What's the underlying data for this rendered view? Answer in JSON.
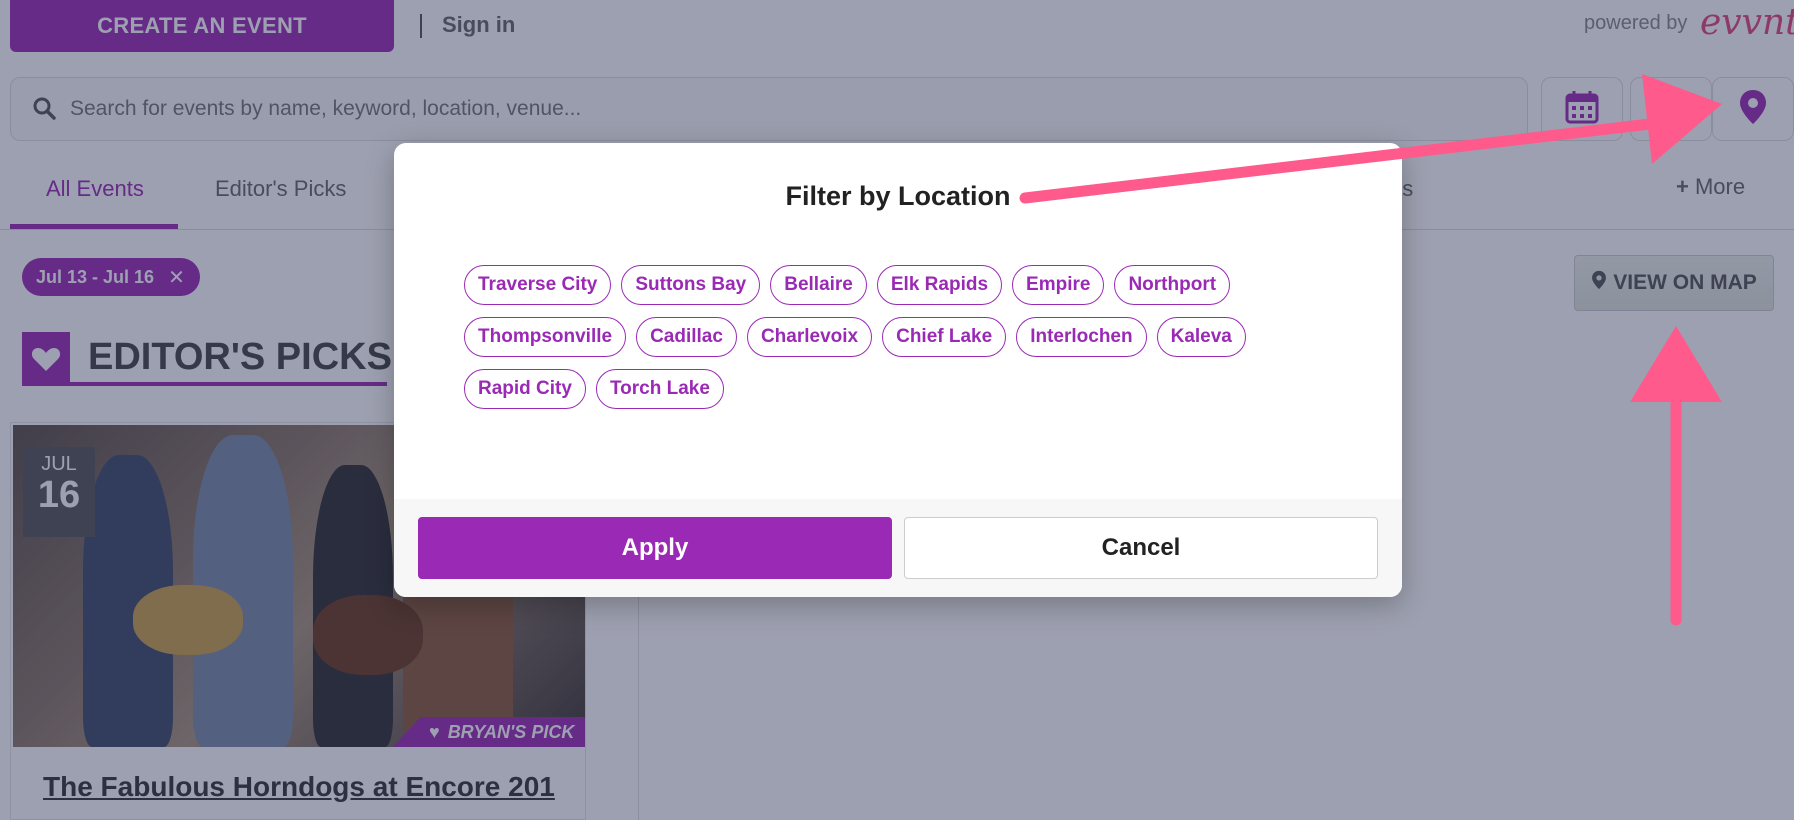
{
  "header": {
    "create_label": "CREATE AN EVENT",
    "signin_label": "Sign in",
    "powered_label": "powered by",
    "brand_label": "evvnt"
  },
  "search": {
    "placeholder": "Search for events by name, keyword, location, venue..."
  },
  "toolbar_icons": [
    "calendar-icon",
    "filter-icon",
    "location-pin-icon"
  ],
  "tabs": {
    "items": [
      {
        "label": "All Events",
        "active": true
      },
      {
        "label": "Editor's Picks",
        "active": false
      },
      {
        "label": "ns",
        "active": false
      }
    ],
    "more_label": "More"
  },
  "filters": {
    "date_chip": "Jul 13 - Jul 16"
  },
  "section": {
    "title": "EDITOR'S PICKS"
  },
  "card": {
    "month": "JUL",
    "day": "16",
    "pick_label": "BRYAN'S PICK",
    "title": "The Fabulous Horndogs at Encore 201"
  },
  "map": {
    "view_label": "VIEW ON MAP"
  },
  "modal": {
    "title": "Filter by Location",
    "locations": [
      "Traverse City",
      "Suttons Bay",
      "Bellaire",
      "Elk Rapids",
      "Empire",
      "Northport",
      "Thompsonville",
      "Cadillac",
      "Charlevoix",
      "Chief Lake",
      "Interlochen",
      "Kaleva",
      "Rapid City",
      "Torch Lake"
    ],
    "apply_label": "Apply",
    "cancel_label": "Cancel"
  },
  "colors": {
    "accent": "#9a2ab5",
    "annotation_arrow": "#ff5a8c",
    "overlay": "rgba(38,44,79,0.45)"
  }
}
